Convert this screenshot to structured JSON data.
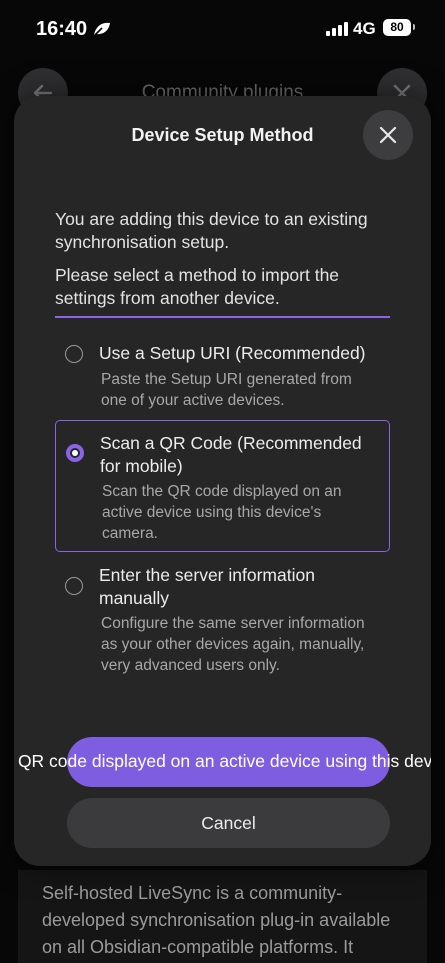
{
  "status": {
    "time": "16:40",
    "network": "4G",
    "battery": "80"
  },
  "background": {
    "title": "Community plugins",
    "body_text": "Self-hosted LiveSync is a community-developed synchronisation plug-in available on all Obsidian-compatible platforms. It"
  },
  "modal": {
    "title": "Device Setup Method",
    "intro_line1": "You are adding this device to an existing synchronisation setup.",
    "intro_line2": "Please select a method to import the settings from another device.",
    "options": [
      {
        "label": "Use a Setup URI (Recommended)",
        "description": "Paste the Setup URI generated from one of your active devices.",
        "selected": false
      },
      {
        "label": "Scan a QR Code (Recommended for mobile)",
        "description": "Scan the QR code displayed on an active device using this device's camera.",
        "selected": true
      },
      {
        "label": "Enter the server information manually",
        "description": "Configure the same server information as your other devices again, manually, very advanced users only.",
        "selected": false
      }
    ],
    "primary_button": "Scan the QR code displayed on an active device using this device's camera.",
    "cancel_button": "Cancel"
  },
  "colors": {
    "accent": "#8a63e6",
    "button": "#7f5de0",
    "modal_bg": "#262626"
  }
}
